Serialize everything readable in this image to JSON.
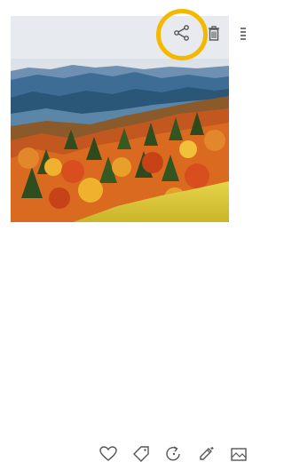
{
  "photo": {
    "subject": "autumn-mountain-landscape"
  },
  "highlight": {
    "target": "share-icon",
    "color": "#f5b800"
  },
  "toolbar": {
    "icons": [
      "share-icon",
      "delete-icon",
      "drag-handle-icon"
    ]
  },
  "bottom_bar": {
    "icons": [
      "heart-icon",
      "tag-icon",
      "rotate-icon",
      "edit-icon",
      "gallery-icon"
    ]
  }
}
